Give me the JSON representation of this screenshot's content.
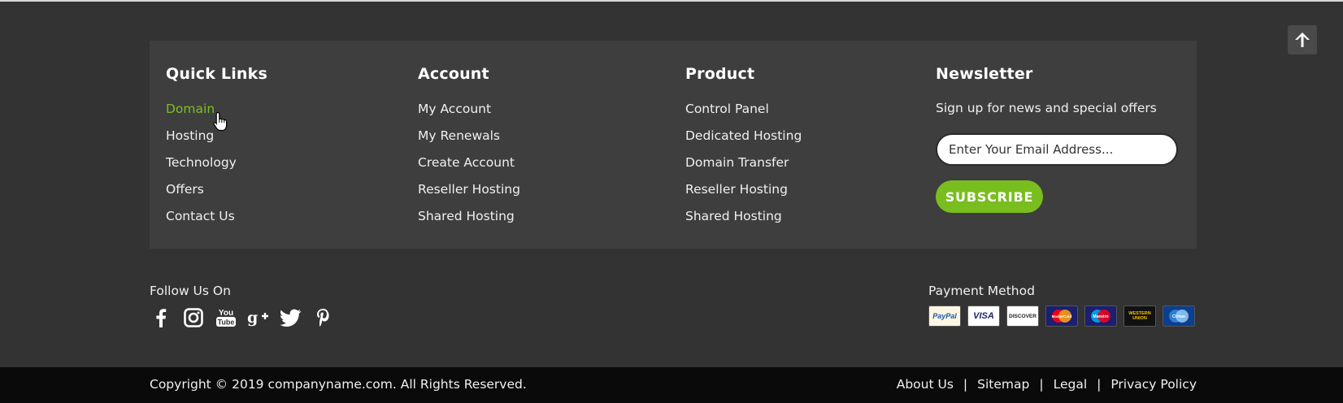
{
  "quick_links": {
    "title": "Quick Links",
    "items": [
      "Domain",
      "Hosting",
      "Technology",
      "Offers",
      "Contact Us"
    ]
  },
  "account": {
    "title": "Account",
    "items": [
      "My Account",
      "My Renewals",
      "Create Account",
      "Reseller Hosting",
      "Shared Hosting"
    ]
  },
  "product": {
    "title": "Product",
    "items": [
      "Control Panel",
      "Dedicated Hosting",
      "Domain Transfer",
      "Reseller Hosting",
      "Shared Hosting"
    ]
  },
  "newsletter": {
    "title": "Newsletter",
    "text": "Sign up for news and special offers",
    "placeholder": "Enter Your Email Address...",
    "button": "SUBSCRIBE"
  },
  "follow": {
    "label": "Follow Us On",
    "icons": [
      "facebook-icon",
      "instagram-icon",
      "youtube-icon",
      "google-plus-icon",
      "twitter-icon",
      "pinterest-icon"
    ]
  },
  "payment": {
    "label": "Payment Method",
    "cards": [
      "PayPal",
      "VISA",
      "DISCOVER",
      "MasterCard",
      "Maestro",
      "WESTERN UNION",
      "Cirrus"
    ]
  },
  "bottom": {
    "copyright": "Copyright © 2019 companyname.com. All Rights Reserved.",
    "links": [
      "About Us",
      "Sitemap",
      "Legal",
      "Privacy Policy"
    ]
  },
  "colors": {
    "background": "#333333",
    "panel": "#3e3e3e",
    "accent": "#79bd1f",
    "bottom_bar": "#0a0a0a"
  }
}
